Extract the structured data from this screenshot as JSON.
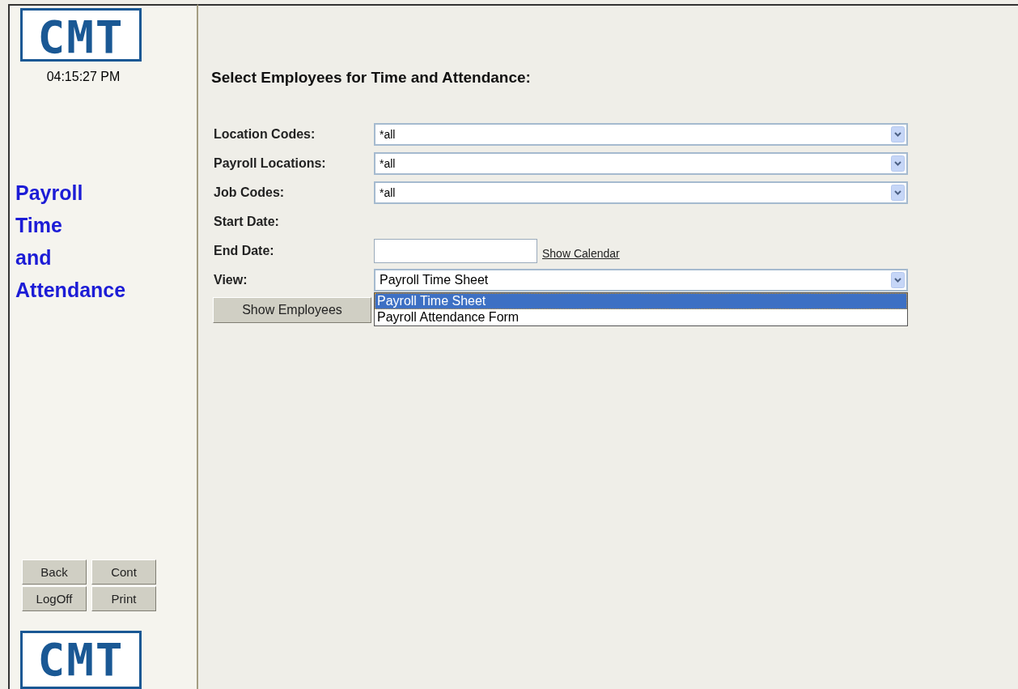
{
  "sidebar": {
    "logo": "CMT",
    "clock": "04:15:27 PM",
    "app_title": [
      "Payroll",
      "Time",
      "and",
      "Attendance"
    ],
    "buttons": [
      {
        "label": "Back"
      },
      {
        "label": "Cont"
      },
      {
        "label": "LogOff"
      },
      {
        "label": "Print"
      }
    ],
    "bottom_logo": "CMT"
  },
  "main": {
    "heading": "Select Employees for Time and Attendance:",
    "fields": [
      {
        "kind": "select",
        "label": "Location Codes:",
        "value": "*all"
      },
      {
        "kind": "select",
        "label": "Payroll Locations:",
        "value": "*all"
      },
      {
        "kind": "select",
        "label": "Job Codes:",
        "value": "*all"
      },
      {
        "kind": "label",
        "label": "Start Date:"
      },
      {
        "kind": "date",
        "label": "End Date:",
        "link": "Show Calendar"
      },
      {
        "kind": "select",
        "label": "View:",
        "value": "Payroll Time Sheet",
        "expanded": true,
        "options": [
          {
            "label": "Payroll Time Sheet",
            "selected": true
          },
          {
            "label": "Payroll Attendance Form",
            "selected": false
          }
        ]
      }
    ],
    "submit": "Show Employees"
  }
}
